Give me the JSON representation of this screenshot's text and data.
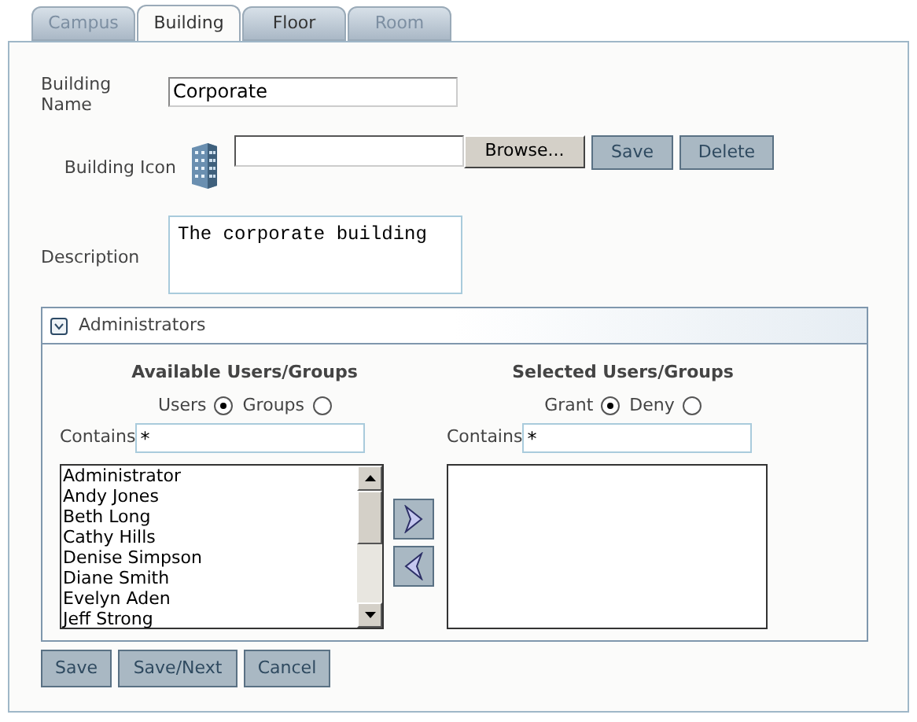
{
  "tabs": [
    {
      "label": "Campus",
      "selected": false,
      "disabled": true
    },
    {
      "label": "Building",
      "selected": true,
      "disabled": false
    },
    {
      "label": "Floor",
      "selected": false,
      "disabled": false
    },
    {
      "label": "Room",
      "selected": false,
      "disabled": true
    }
  ],
  "building_name": {
    "label": "Building Name",
    "value": "Corporate"
  },
  "building_icon": {
    "label": "Building Icon",
    "browse": "Browse...",
    "save": "Save",
    "delete": "Delete"
  },
  "description": {
    "label": "Description",
    "value": "The corporate building"
  },
  "administrators": {
    "title": "Administrators",
    "expanded": true,
    "available": {
      "heading": "Available Users/Groups",
      "options": [
        {
          "label": "Users",
          "selected": true
        },
        {
          "label": "Groups",
          "selected": false
        }
      ],
      "contains_label": "Contains",
      "contains_value": "*",
      "items": [
        "Administrator",
        "Andy Jones",
        "Beth Long",
        "Cathy Hills",
        "Denise Simpson",
        "Diane Smith",
        "Evelyn Aden",
        "Jeff Strong"
      ]
    },
    "selected_list": {
      "heading": "Selected Users/Groups",
      "options": [
        {
          "label": "Grant",
          "selected": true
        },
        {
          "label": "Deny",
          "selected": false
        }
      ],
      "contains_label": "Contains",
      "contains_value": "*"
    }
  },
  "buttons": [
    "Save",
    "Save/Next",
    "Cancel"
  ]
}
